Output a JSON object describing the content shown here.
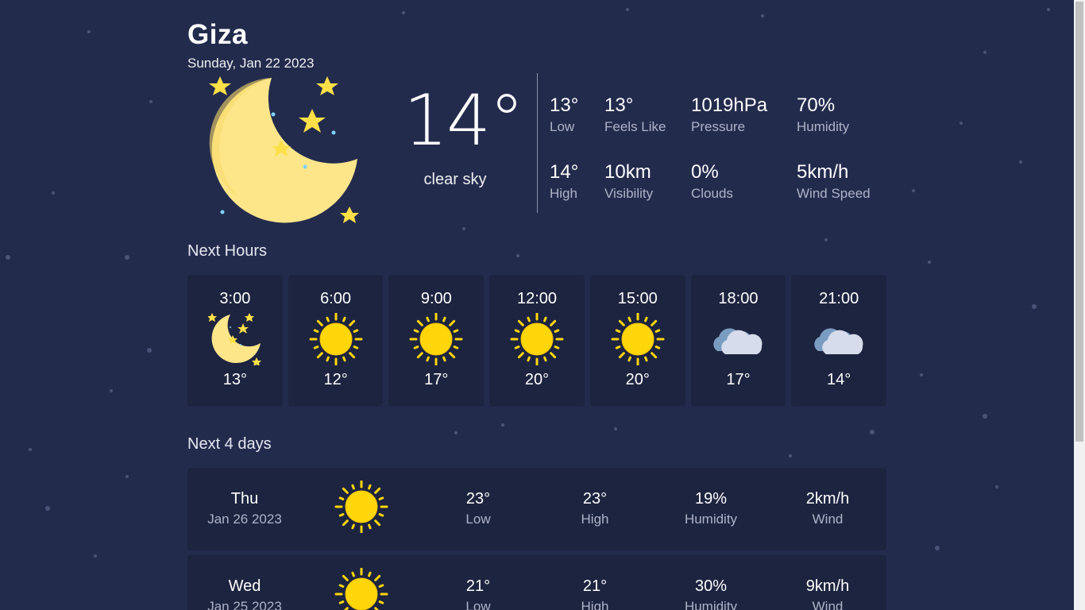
{
  "current": {
    "city": "Giza",
    "date": "Sunday, Jan 22 2023",
    "icon": "moon-stars-icon",
    "temp": "14°",
    "description": "clear sky",
    "stats": [
      {
        "value": "13°",
        "label": "Low"
      },
      {
        "value": "13°",
        "label": "Feels Like"
      },
      {
        "value": "1019hPa",
        "label": "Pressure"
      },
      {
        "value": "70%",
        "label": "Humidity"
      },
      {
        "value": "14°",
        "label": "High"
      },
      {
        "value": "10km",
        "label": "Visibility"
      },
      {
        "value": "0%",
        "label": "Clouds"
      },
      {
        "value": "5km/h",
        "label": "Wind Speed"
      }
    ]
  },
  "next_hours": {
    "title": "Next Hours",
    "items": [
      {
        "time": "3:00",
        "icon": "moon-stars-icon",
        "temp": "13°"
      },
      {
        "time": "6:00",
        "icon": "sun-icon",
        "temp": "12°"
      },
      {
        "time": "9:00",
        "icon": "sun-icon",
        "temp": "17°"
      },
      {
        "time": "12:00",
        "icon": "sun-icon",
        "temp": "20°"
      },
      {
        "time": "15:00",
        "icon": "sun-icon",
        "temp": "20°"
      },
      {
        "time": "18:00",
        "icon": "cloud-icon",
        "temp": "17°"
      },
      {
        "time": "21:00",
        "icon": "cloud-icon",
        "temp": "14°"
      }
    ]
  },
  "next_days": {
    "title": "Next 4 days",
    "items": [
      {
        "day": "Thu",
        "date": "Jan 26 2023",
        "icon": "sun-icon",
        "low": "23°",
        "low_label": "Low",
        "high": "23°",
        "high_label": "High",
        "humidity": "19%",
        "humidity_label": "Humidity",
        "wind": "2km/h",
        "wind_label": "Wind"
      },
      {
        "day": "Wed",
        "date": "Jan 25 2023",
        "icon": "sun-icon",
        "low": "21°",
        "low_label": "Low",
        "high": "21°",
        "high_label": "High",
        "humidity": "30%",
        "humidity_label": "Humidity",
        "wind": "9km/h",
        "wind_label": "Wind"
      }
    ]
  },
  "colors": {
    "background": "#232b4d",
    "card": "#1d2440",
    "sun": "#ffd60a",
    "moon": "#fde68a",
    "muted_text": "#aeb3c8"
  }
}
